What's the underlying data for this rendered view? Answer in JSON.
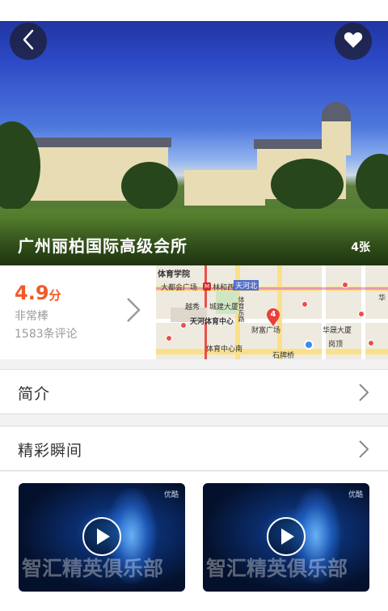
{
  "header": {
    "back_icon": "chevron-left-icon",
    "favorite_icon": "heart-icon",
    "venue_name": "广州丽柏国际高级会所",
    "photo_count": "4张"
  },
  "rating": {
    "score": "4.9",
    "score_unit": "分",
    "label": "非常棒",
    "reviews": "1583条评论",
    "accent_color": "#f05a28"
  },
  "map": {
    "labels": [
      "体育学院",
      "大都会广场",
      "林和西",
      "天河北",
      "越秀",
      "城建大厦",
      "体育东路",
      "天河体育中心",
      "财富广场",
      "华晟大厦",
      "华",
      "体育中心南",
      "石牌桥",
      "岗顶"
    ],
    "marker_number": "4"
  },
  "sections": {
    "intro_label": "简介",
    "moments_label": "精彩瞬间"
  },
  "videos": [
    {
      "brand": "优酷",
      "watermark": "智汇精英俱乐部"
    },
    {
      "brand": "优酷",
      "watermark": "智汇精英俱乐部"
    }
  ]
}
